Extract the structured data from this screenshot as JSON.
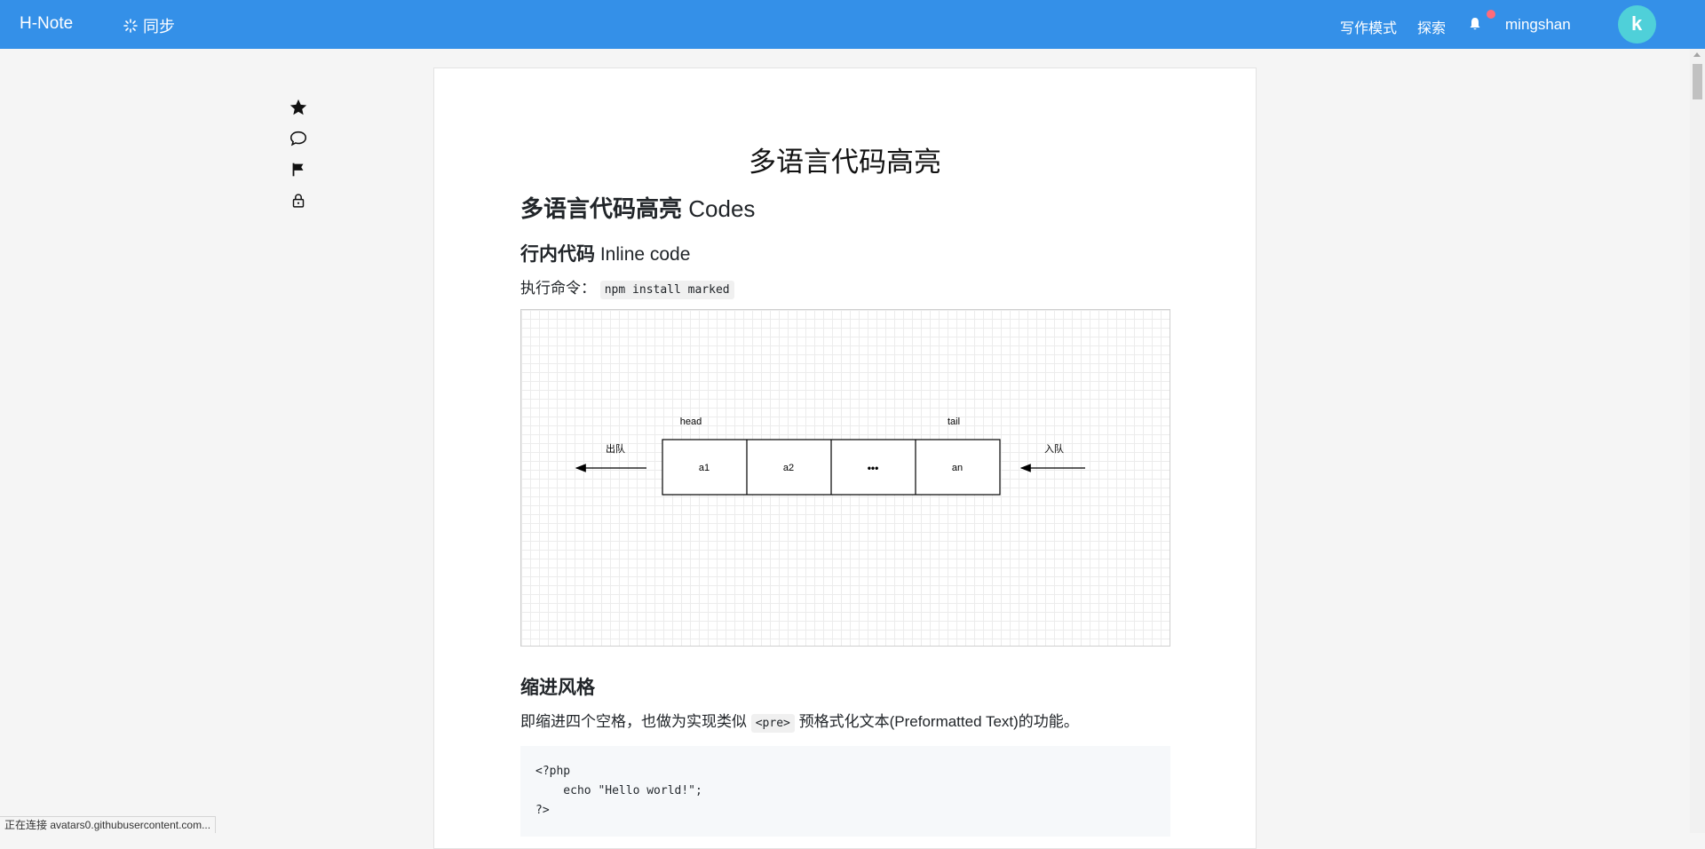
{
  "topbar": {
    "brand": "H-Note",
    "sync_label": "同步",
    "write_mode": "写作模式",
    "explore": "探索",
    "username": "mingshan",
    "colors": {
      "bar": "#3490e8",
      "avatar": "#4fd0d9",
      "notify_dot": "#ff6b7a"
    }
  },
  "rail": {
    "icons": [
      "star-icon",
      "comment-icon",
      "flag-icon",
      "lock-icon"
    ]
  },
  "article": {
    "title": "多语言代码高亮",
    "h1_cn": "多语言代码高亮",
    "h1_en": "Codes",
    "h2_inline_cn": "行内代码",
    "h2_inline_en": "Inline code",
    "exec_label": "执行命令：",
    "exec_code": "npm install marked",
    "diagram": {
      "head_label": "head",
      "tail_label": "tail",
      "dequeue_label": "出队",
      "enqueue_label": "入队",
      "cells": [
        "a1",
        "a2",
        "•••",
        "an"
      ]
    },
    "h2_indent": "缩进风格",
    "indent_text_before": "即缩进四个空格，也做为实现类似",
    "indent_code": "<pre>",
    "indent_text_after": "预格式化文本(Preformatted Text)的功能。",
    "pre_block": "<?php\n    echo \"Hello world!\";\n?>"
  },
  "status": {
    "text": "正在连接 avatars0.githubusercontent.com..."
  }
}
